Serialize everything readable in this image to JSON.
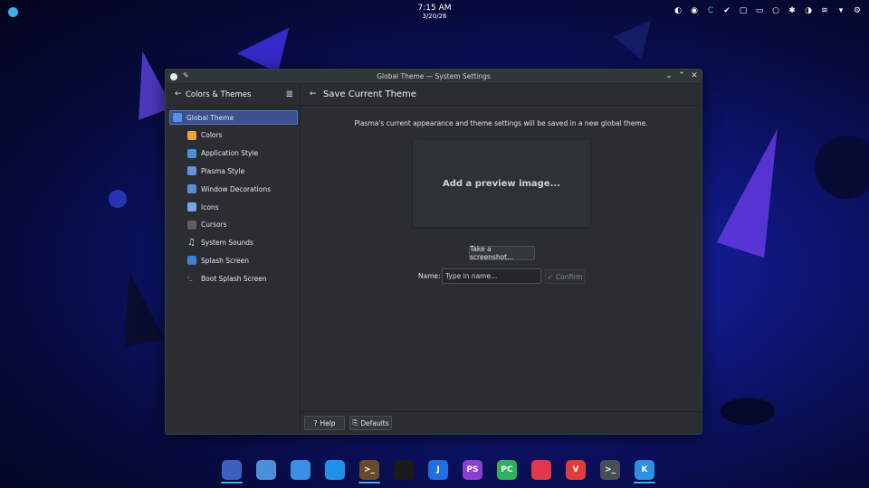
{
  "panel": {
    "time": "7:15 AM",
    "date": "3/20/26",
    "tray_icons": [
      "update-icon",
      "password-manager-icon",
      "sync-icon",
      "check-icon",
      "clipboard-icon",
      "chat-icon",
      "record-icon",
      "bluetooth-icon",
      "display-icon",
      "wifi-icon",
      "expand-icon",
      "settings-icon"
    ]
  },
  "window": {
    "title": "Global Theme — System Settings"
  },
  "sidebar": {
    "title": "Colors & Themes",
    "items": [
      {
        "label": "Global Theme",
        "icon": "global-theme-icon",
        "color": "#5b8fe6"
      },
      {
        "label": "Colors",
        "icon": "colors-icon",
        "color": "#e9a43d"
      },
      {
        "label": "Application Style",
        "icon": "application-style-icon",
        "color": "#4a90d9"
      },
      {
        "label": "Plasma Style",
        "icon": "plasma-style-icon",
        "color": "#6a8fe0"
      },
      {
        "label": "Window Decorations",
        "icon": "window-decorations-icon",
        "color": "#5d8ad8"
      },
      {
        "label": "Icons",
        "icon": "icons-icon",
        "color": "#7aa5e8"
      },
      {
        "label": "Cursors",
        "icon": "cursors-icon",
        "color": "#5c6066"
      },
      {
        "label": "System Sounds",
        "icon": "music-note-icon",
        "color": "#2a2e32"
      },
      {
        "label": "Splash Screen",
        "icon": "splash-screen-icon",
        "color": "#3f7fd4"
      },
      {
        "label": "Boot Splash Screen",
        "icon": "boot-splash-icon",
        "color": "#2a2e32"
      }
    ]
  },
  "content": {
    "title": "Save Current Theme",
    "description": "Plasma's current appearance and theme settings will be saved in a new global theme.",
    "preview_text": "Add a preview image...",
    "screenshot_button": "Take a screenshot...",
    "name_label": "Name:",
    "name_placeholder": "Type in name...",
    "confirm_button": "Confirm"
  },
  "footer": {
    "help_label": "Help",
    "defaults_label": "Defaults"
  },
  "dock": [
    {
      "name": "dock-app-switcher",
      "icon": "circle-toggle-icon",
      "color": "#3f5fbf",
      "text": "",
      "running": true
    },
    {
      "name": "dock-file-manager",
      "icon": "folder-icon",
      "color": "#4a8fd8",
      "text": "",
      "running": false
    },
    {
      "name": "dock-mail",
      "icon": "mail-icon",
      "color": "#3a8ee6",
      "text": "",
      "running": false
    },
    {
      "name": "dock-app-blue",
      "icon": "blue-app-icon",
      "color": "#1e90e8",
      "text": "",
      "running": false
    },
    {
      "name": "dock-terminal-cat",
      "icon": "terminal-icon",
      "color": "#6b4a2a",
      "text": ">_",
      "running": true
    },
    {
      "name": "dock-obs",
      "icon": "obs-icon",
      "color": "#1a1a1a",
      "text": "",
      "running": false
    },
    {
      "name": "dock-joplin",
      "icon": "joplin-icon",
      "color": "#1f6fe0",
      "text": "J",
      "running": false
    },
    {
      "name": "dock-phpstorm",
      "icon": "phpstorm-icon",
      "color": "#8a3fd0",
      "text": "PS",
      "running": false
    },
    {
      "name": "dock-pycharm",
      "icon": "pycharm-icon",
      "color": "#2fb35a",
      "text": "PC",
      "running": false
    },
    {
      "name": "dock-chat",
      "icon": "chat-bubble-icon",
      "color": "#e0394a",
      "text": "",
      "running": false
    },
    {
      "name": "dock-vivaldi",
      "icon": "vivaldi-icon",
      "color": "#e23a3a",
      "text": "V",
      "running": false
    },
    {
      "name": "dock-konsole",
      "icon": "console-icon",
      "color": "#4a4f55",
      "text": ">_",
      "running": false
    },
    {
      "name": "dock-kde-settings",
      "icon": "kde-icon",
      "color": "#2f8fe0",
      "text": "K",
      "running": true
    }
  ]
}
